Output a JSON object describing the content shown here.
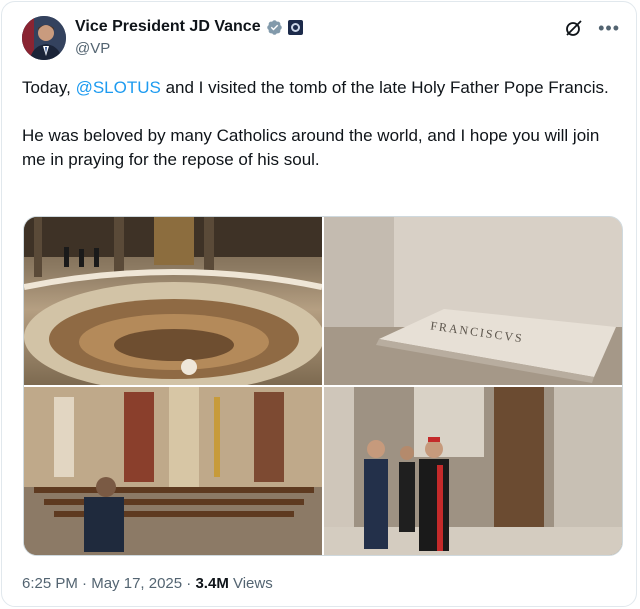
{
  "author": {
    "name": "Vice President JD Vance",
    "handle": "@VP"
  },
  "icons": {
    "verified": "verified-badge-icon",
    "government": "government-affiliation-icon",
    "grok": "grok-icon",
    "more": "more-options-icon"
  },
  "tweet": {
    "line1_prefix": "Today, ",
    "line1_mention": "@SLOTUS",
    "line1_suffix": " and I visited the tomb of the late Holy Father Pope Francis.",
    "line2": "He was beloved by many Catholics around the world, and I hope you will join me in praying for the repose of his soul."
  },
  "media": {
    "tomb_inscription": "FRANCISCVS"
  },
  "meta": {
    "time": "6:25 PM",
    "separator": " · ",
    "date": "May 17, 2025",
    "views_count": "3.4M",
    "views_label": " Views"
  },
  "colors": {
    "link": "#1d9bf0",
    "secondary_text": "#536471",
    "verified": "#829aab"
  }
}
